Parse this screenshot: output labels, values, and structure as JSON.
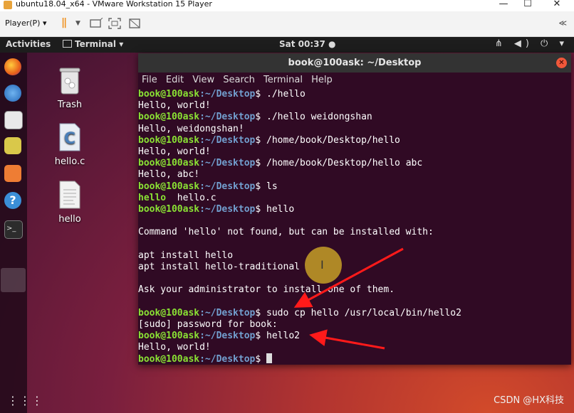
{
  "vmware": {
    "window_title": "ubuntu18.04_x64 - VMware Workstation 15 Player",
    "min_glyph": "—",
    "max_glyph": "☐",
    "close_glyph": "✕",
    "player_menu": "Player(P) ▾",
    "pause_glyph": "||",
    "collapse_glyph": "≪"
  },
  "ubuntu": {
    "activities": "Activities",
    "app_menu": "Terminal ▾",
    "clock": "Sat 00:37 ●",
    "tray": "⋔ ◀) ⏻ ▾"
  },
  "desktop_items": [
    {
      "label": "Trash",
      "icon": "trash-icon"
    },
    {
      "label": "hello.c",
      "icon": "c-file-icon"
    },
    {
      "label": "hello",
      "icon": "text-file-icon"
    }
  ],
  "terminal": {
    "title": "book@100ask: ~/Desktop",
    "menu": [
      "File",
      "Edit",
      "View",
      "Search",
      "Terminal",
      "Help"
    ],
    "prompt_user": "book@100ask",
    "prompt_path": ":~/Desktop",
    "lines": [
      {
        "type": "cmd",
        "text": "$ ./hello"
      },
      {
        "type": "out",
        "text": "Hello, world!"
      },
      {
        "type": "cmd",
        "text": "$ ./hello weidongshan"
      },
      {
        "type": "out",
        "text": "Hello, weidongshan!"
      },
      {
        "type": "cmd",
        "text": "$ /home/book/Desktop/hello"
      },
      {
        "type": "out",
        "text": "Hello, world!"
      },
      {
        "type": "cmd",
        "text": "$ /home/book/Desktop/hello abc"
      },
      {
        "type": "out",
        "text": "Hello, abc!"
      },
      {
        "type": "cmd",
        "text": "$ ls"
      },
      {
        "type": "ls",
        "exe": "hello",
        "rest": "  hello.c"
      },
      {
        "type": "cmd",
        "text": "$ hello"
      },
      {
        "type": "out",
        "text": ""
      },
      {
        "type": "out",
        "text": "Command 'hello' not found, but can be installed with:"
      },
      {
        "type": "out",
        "text": ""
      },
      {
        "type": "out",
        "text": "apt install hello"
      },
      {
        "type": "out",
        "text": "apt install hello-traditional"
      },
      {
        "type": "out",
        "text": ""
      },
      {
        "type": "out",
        "text": "Ask your administrator to install one of them."
      },
      {
        "type": "out",
        "text": ""
      },
      {
        "type": "cmd",
        "text": "$ sudo cp hello /usr/local/bin/hello2"
      },
      {
        "type": "out",
        "text": "[sudo] password for book:"
      },
      {
        "type": "cmd",
        "text": "$ hello2"
      },
      {
        "type": "out",
        "text": "Hello, world!"
      },
      {
        "type": "cmd",
        "text": "$ "
      }
    ]
  },
  "colors": {
    "terminal_bg": "#300a24",
    "prompt_user": "#8ae234",
    "prompt_path": "#729fcf",
    "annotation_arrow": "#ff1a1a"
  },
  "watermark": "CSDN @HX科技"
}
